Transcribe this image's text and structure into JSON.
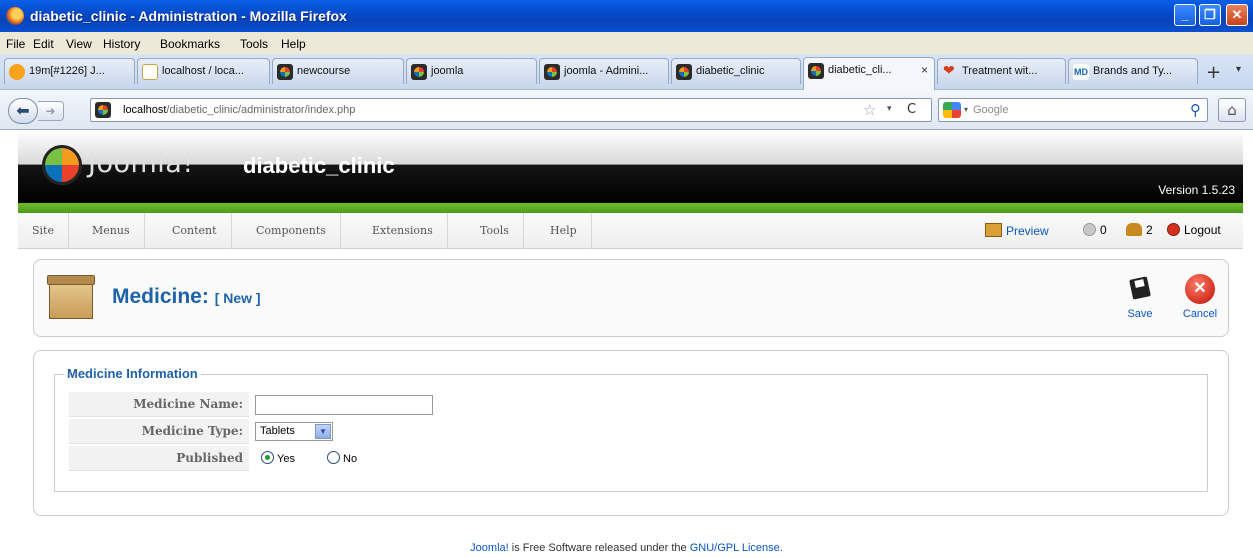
{
  "window": {
    "title": "diabetic_clinic - Administration - Mozilla Firefox"
  },
  "menubar": {
    "items": [
      "File",
      "Edit",
      "View",
      "History",
      "Bookmarks",
      "Tools",
      "Help"
    ]
  },
  "tabs": [
    {
      "label": "19m[#1226] J...",
      "icon": "clock-icon"
    },
    {
      "label": "localhost / loca...",
      "icon": "phpmyadmin-icon"
    },
    {
      "label": "newcourse",
      "icon": "joomla-icon"
    },
    {
      "label": "joomla",
      "icon": "joomla-icon"
    },
    {
      "label": "joomla - Admini...",
      "icon": "joomla-icon"
    },
    {
      "label": "diabetic_clinic",
      "icon": "joomla-icon"
    },
    {
      "label": "diabetic_cli...",
      "icon": "joomla-icon",
      "active": true
    },
    {
      "label": "Treatment wit...",
      "icon": "heart-icon"
    },
    {
      "label": "Brands and Ty...",
      "icon": "webmd-icon"
    }
  ],
  "tab_close_symbol": "×",
  "navbar": {
    "url_host": "localhost",
    "url_path": "/diabetic_clinic/administrator/index.php",
    "search_placeholder": "Google"
  },
  "joomla": {
    "logo_text": "Joomla!",
    "site_name": "diabetic_clinic",
    "version": "Version 1.5.23",
    "brand_green": "#5aa91f",
    "menu": [
      "Site",
      "Menus",
      "Content",
      "Components",
      "Extensions",
      "Tools",
      "Help"
    ],
    "status": {
      "preview": "Preview",
      "messages": "0",
      "users": "2",
      "logout": "Logout"
    }
  },
  "toolbar": {
    "title": "Medicine:",
    "subtitle": "[ New ]",
    "save_label": "Save",
    "cancel_label": "Cancel"
  },
  "form": {
    "legend": "Medicine Information",
    "fields": {
      "name_label": "Medicine Name:",
      "name_value": "",
      "type_label": "Medicine Type:",
      "type_value": "Tablets",
      "published_label": "Published",
      "published_yes": "Yes",
      "published_no": "No",
      "published_selected": "Yes"
    }
  },
  "footer": {
    "joomla_link": "Joomla!",
    "middle": " is Free Software released under the ",
    "license_link": "GNU/GPL License",
    "end": "."
  }
}
